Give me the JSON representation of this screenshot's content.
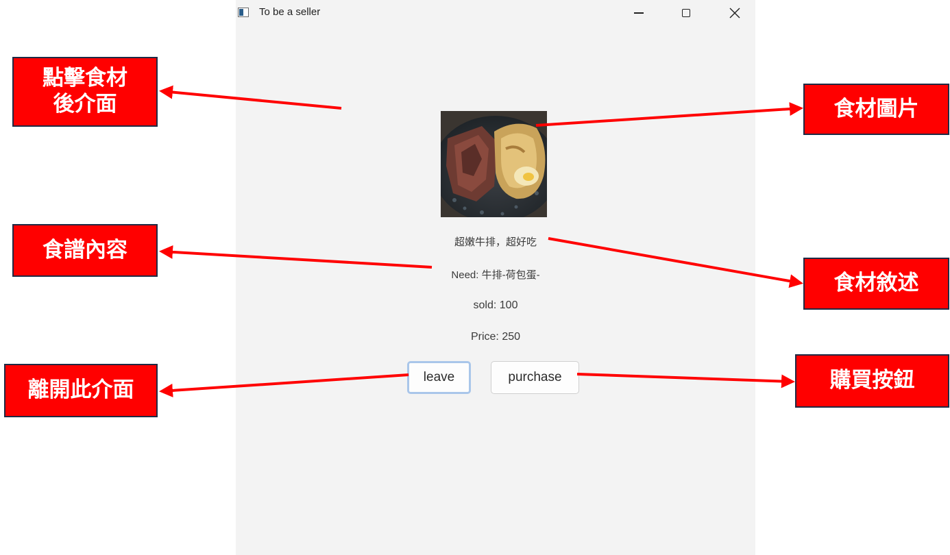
{
  "window": {
    "title": "To be a seller",
    "controls": {
      "minimize": "minimize-icon",
      "maximize": "maximize-icon",
      "close": "close-icon"
    }
  },
  "item": {
    "image_alt": "steak-with-fried-egg-image",
    "description": "超嫩牛排，超好吃",
    "need": "Need: 牛排-荷包蛋-",
    "sold": "sold: 100",
    "price": "Price: 250"
  },
  "buttons": {
    "leave": "leave",
    "purchase": "purchase"
  },
  "annotations": {
    "interface_after_click": [
      "點擊食材",
      "後介面"
    ],
    "ingredient_image": "食材圖片",
    "recipe_content": "食譜內容",
    "ingredient_description": "食材敘述",
    "leave_interface": "離開此介面",
    "purchase_button": "購買按鈕"
  },
  "colors": {
    "annotation_fill": "#ff0000",
    "arrow": "#ff0000",
    "window_bg": "#f3f3f3",
    "focus_ring": "#a9c6ea"
  }
}
